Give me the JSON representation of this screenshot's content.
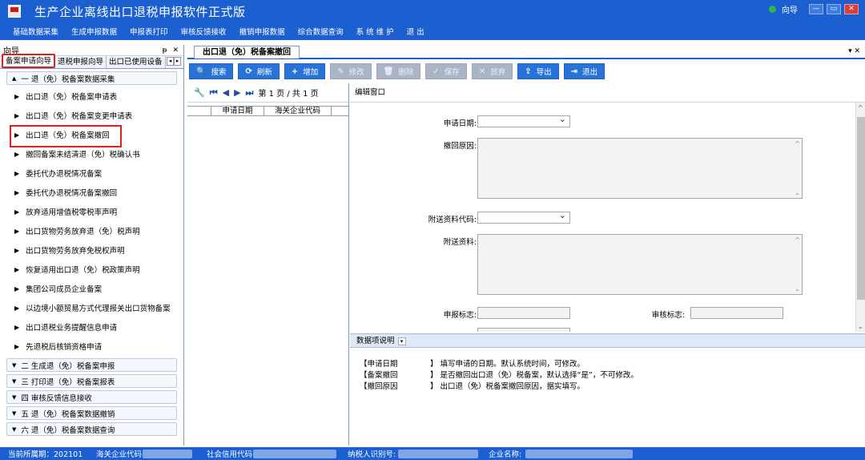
{
  "window": {
    "title": "生产企业离线出口退税申报软件正式版",
    "wizard_label": "向导",
    "controls": [
      "—",
      "▭",
      "✕"
    ]
  },
  "menu": [
    "基础数据采集",
    "生成申报数据",
    "申报表打印",
    "审核反馈接收",
    "撤销申报数据",
    "综合数据查询",
    "系 统 维 护",
    "退 出"
  ],
  "left_panel": {
    "title": "向导",
    "controls": "ᵽ ✕",
    "tabs": [
      "备案申请向导",
      "退税申报向导",
      "出口已使用设备"
    ],
    "sections": [
      {
        "label": "一 退（免）税备案数据采集",
        "expanded": true,
        "items": [
          "出口退（免）税备案申请表",
          "出口退（免）税备案变更申请表",
          "出口退（免）税备案撤回",
          "撤回备案未结清退（免）税确认书",
          "委托代办退税情况备案",
          "委托代办退税情况备案撤回",
          "放弃适用增值税零税率声明",
          "出口货物劳务放弃退（免）税声明",
          "出口货物劳务放弃免税权声明",
          "恢复适用出口退（免）税政策声明",
          "集团公司成员企业备案",
          "以边境小额贸易方式代理报关出口货物备案",
          "出口退税业务提醒信息申请",
          "先退税后核销资格申请"
        ]
      },
      {
        "label": "二 生成退（免）税备案申报",
        "expanded": false
      },
      {
        "label": "三 打印退（免）税备案报表",
        "expanded": false
      },
      {
        "label": "四 审核反馈信息接收",
        "expanded": false
      },
      {
        "label": "五 退（免）税备案数据撤销",
        "expanded": false
      },
      {
        "label": "六 退（免）税备案数据查询",
        "expanded": false
      }
    ]
  },
  "main": {
    "tab_label": "出口退（免）税备案撤回",
    "tab_close": "▾ ✕",
    "toolbar": [
      {
        "icon": "search-icon",
        "glyph": "🔍",
        "label": "搜索",
        "enabled": true
      },
      {
        "icon": "refresh-icon",
        "glyph": "⟳",
        "label": "刷新",
        "enabled": true
      },
      {
        "icon": "plus-icon",
        "glyph": "+",
        "label": "增加",
        "enabled": true
      },
      {
        "icon": "edit-icon",
        "glyph": "✎",
        "label": "修改",
        "enabled": false
      },
      {
        "icon": "trash-icon",
        "glyph": "🗑",
        "label": "删除",
        "enabled": false
      },
      {
        "icon": "check-icon",
        "glyph": "✓",
        "label": "保存",
        "enabled": false
      },
      {
        "icon": "x-icon",
        "glyph": "✕",
        "label": "放弃",
        "enabled": false
      },
      {
        "icon": "export-icon",
        "glyph": "⇪",
        "label": "导出",
        "enabled": true
      },
      {
        "icon": "exit-icon",
        "glyph": "⇥",
        "label": "退出",
        "enabled": true
      }
    ],
    "pager": {
      "text": "第 1 页 / 共 1 页"
    },
    "grid_columns": [
      "申请日期",
      "海关企业代码"
    ],
    "edit_window_title": "编辑窗口",
    "form": {
      "apply_date_label": "申请日期:",
      "revoke_reason_label": "撤回原因:",
      "attach_code_label": "附送资料代码:",
      "attach_label": "附送资料:",
      "declare_flag_label": "申报标志:",
      "audit_flag_label": "审核标志:"
    },
    "desc_title": "数据项说明",
    "desc_rows": [
      {
        "k": "【申请日期",
        "v": "】 填写申请的日期。默认系统时间，可修改。"
      },
      {
        "k": "【备案撤回",
        "v": "】 是否撤回出口退（免）税备案，默认选择“是”，不可修改。"
      },
      {
        "k": "【撤回原因",
        "v": "】 出口退（免）税备案撤回原因，据实填写。"
      }
    ]
  },
  "status": {
    "period": "当前所属期：202101",
    "customs_code_label": "海关企业代码",
    "credit_code_label": "社会信用代码",
    "taxpayer_id_label": "纳税人识别号:",
    "company_name_label": "企业名称:"
  }
}
